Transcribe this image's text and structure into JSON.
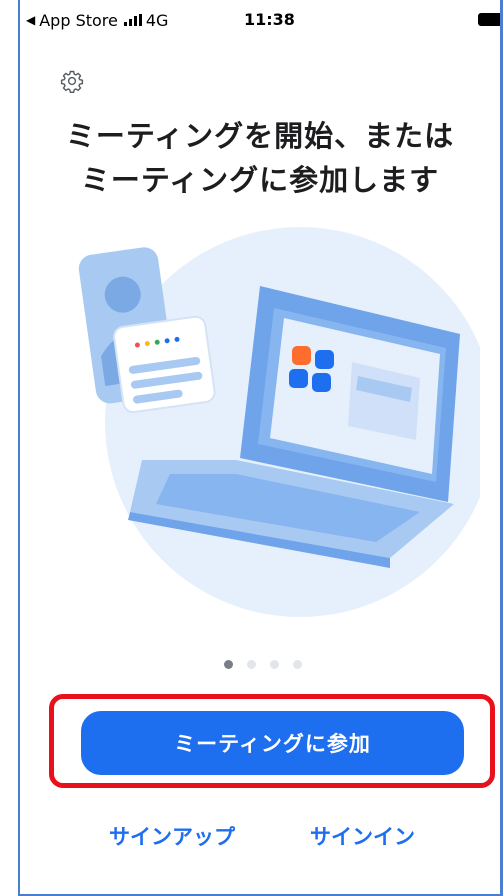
{
  "status_bar": {
    "back_indicator": "◀",
    "carrier": "App Store",
    "network": "4G",
    "time": "11:38"
  },
  "settings": {
    "icon": "gear-icon"
  },
  "title": {
    "line1": "ミーティングを開始、または",
    "line2": "ミーティングに参加します"
  },
  "pager": {
    "count": 4,
    "active_index": 0
  },
  "actions": {
    "join_label": "ミーティングに参加",
    "signup_label": "サインアップ",
    "signin_label": "サインイン"
  },
  "colors": {
    "accent": "#1e6ef0",
    "highlight": "#e8101a"
  }
}
